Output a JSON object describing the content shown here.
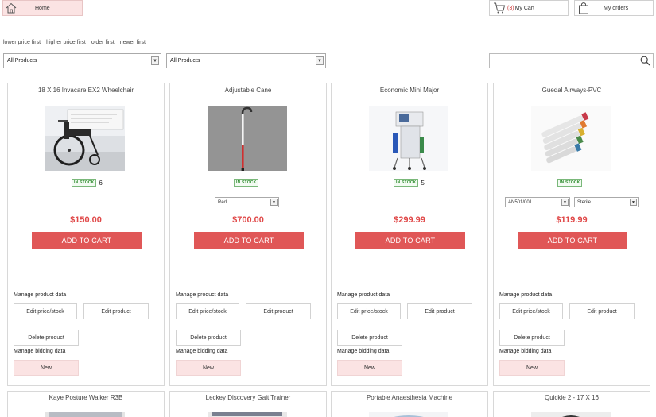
{
  "header": {
    "home_label": "Home",
    "cart_count": "(3)",
    "cart_label": "My Cart",
    "orders_label": "My orders"
  },
  "sort": {
    "lower": "lower price first",
    "higher": "higher price first",
    "older": "older first",
    "newer": "newer first"
  },
  "filters": {
    "category_value": "All Products",
    "subcategory_value": "All Products",
    "search_value": ""
  },
  "labels": {
    "in_stock": "IN STOCK",
    "add_to_cart": "ADD TO CART",
    "manage_product": "Manage product data",
    "edit_price": "Edit price/stock",
    "edit_product": "Edit product",
    "delete_product": "Delete product",
    "manage_bidding": "Manage bidding data",
    "new": "New"
  },
  "products": [
    {
      "title": "18 X 16 Invacare EX2 Wheelchair",
      "price": "$150.00",
      "stock_qty": "6"
    },
    {
      "title": "Adjustable Cane",
      "price": "$700.00",
      "option1": "Red"
    },
    {
      "title": "Economic Mini Major",
      "price": "$299.99",
      "stock_qty": "5"
    },
    {
      "title": "Guedal Airways-PVC",
      "price": "$119.99",
      "option1": "AN501/001",
      "option2": "Sterile"
    }
  ],
  "products_row2": [
    {
      "title": "Kaye Posture Walker R3B"
    },
    {
      "title": "Leckey Discovery Gait Trainer"
    },
    {
      "title": "Portable Anaesthesia Machine"
    },
    {
      "title": "Quickie 2 - 17 X 16"
    }
  ],
  "colors": {
    "accent": "#e05757",
    "price": "#e04848",
    "soft_pink": "#fbe3e3",
    "stock_green": "#2a8a2a"
  }
}
